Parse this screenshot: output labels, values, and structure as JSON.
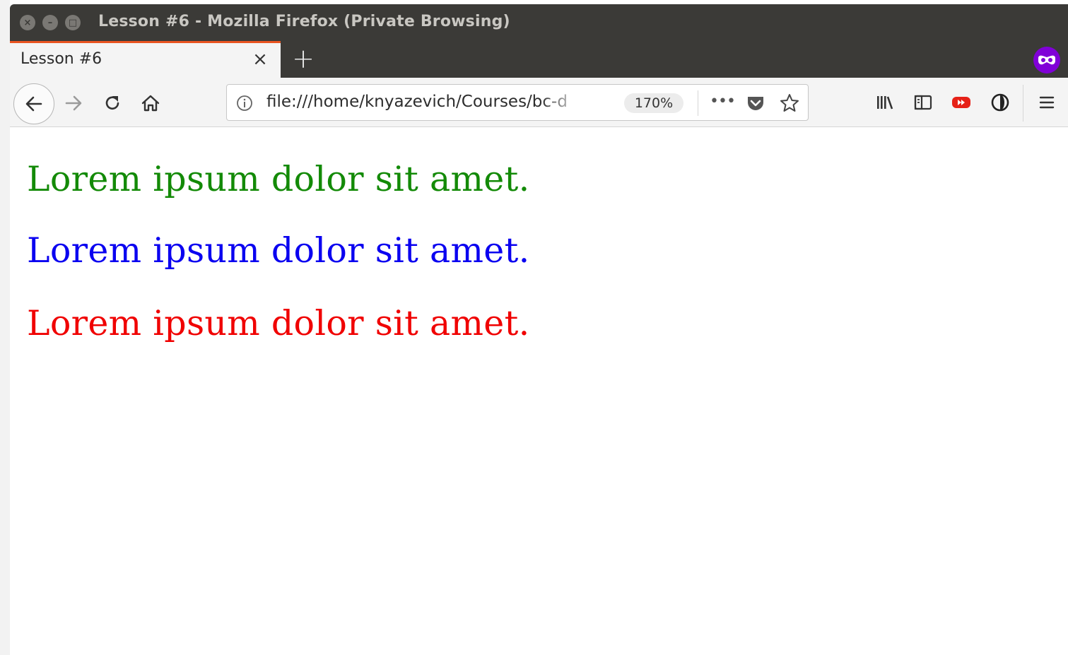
{
  "window": {
    "title": "Lesson #6 - Mozilla Firefox (Private Browsing)",
    "controls": {
      "close_glyph": "×",
      "minimize_glyph": "–",
      "maximize_glyph": "□"
    }
  },
  "tabs": [
    {
      "title": "Lesson #6",
      "active": true,
      "close_glyph": "×"
    }
  ],
  "new_tab_glyph": "+",
  "private_badge_icon": "private-browsing-mask-icon",
  "navbar": {
    "back_icon": "back-arrow-icon",
    "forward_icon": "forward-arrow-icon",
    "reload_icon": "reload-icon",
    "home_icon": "home-icon",
    "url": "file:///home/knyazevich/Courses/bc-d",
    "zoom": "170%",
    "page_actions_glyph": "•••",
    "pocket_icon": "pocket-icon",
    "bookmark_icon": "star-icon",
    "toolbar_icons": [
      "library-icon",
      "sidebar-icon",
      "youtube-extension-icon",
      "extension-icon",
      "hamburger-menu-icon"
    ]
  },
  "page": {
    "paragraphs": [
      {
        "text": "Lorem ipsum dolor sit amet.",
        "color": "#138a07"
      },
      {
        "text": "Lorem ipsum dolor sit amet.",
        "color": "#0a00f0"
      },
      {
        "text": "Lorem ipsum dolor sit amet.",
        "color": "#f00000"
      }
    ]
  },
  "colors": {
    "titlebar": "#3b3a37",
    "tab_accent": "#e95420",
    "private_purple": "#8000d7",
    "youtube_red": "#e62117"
  }
}
